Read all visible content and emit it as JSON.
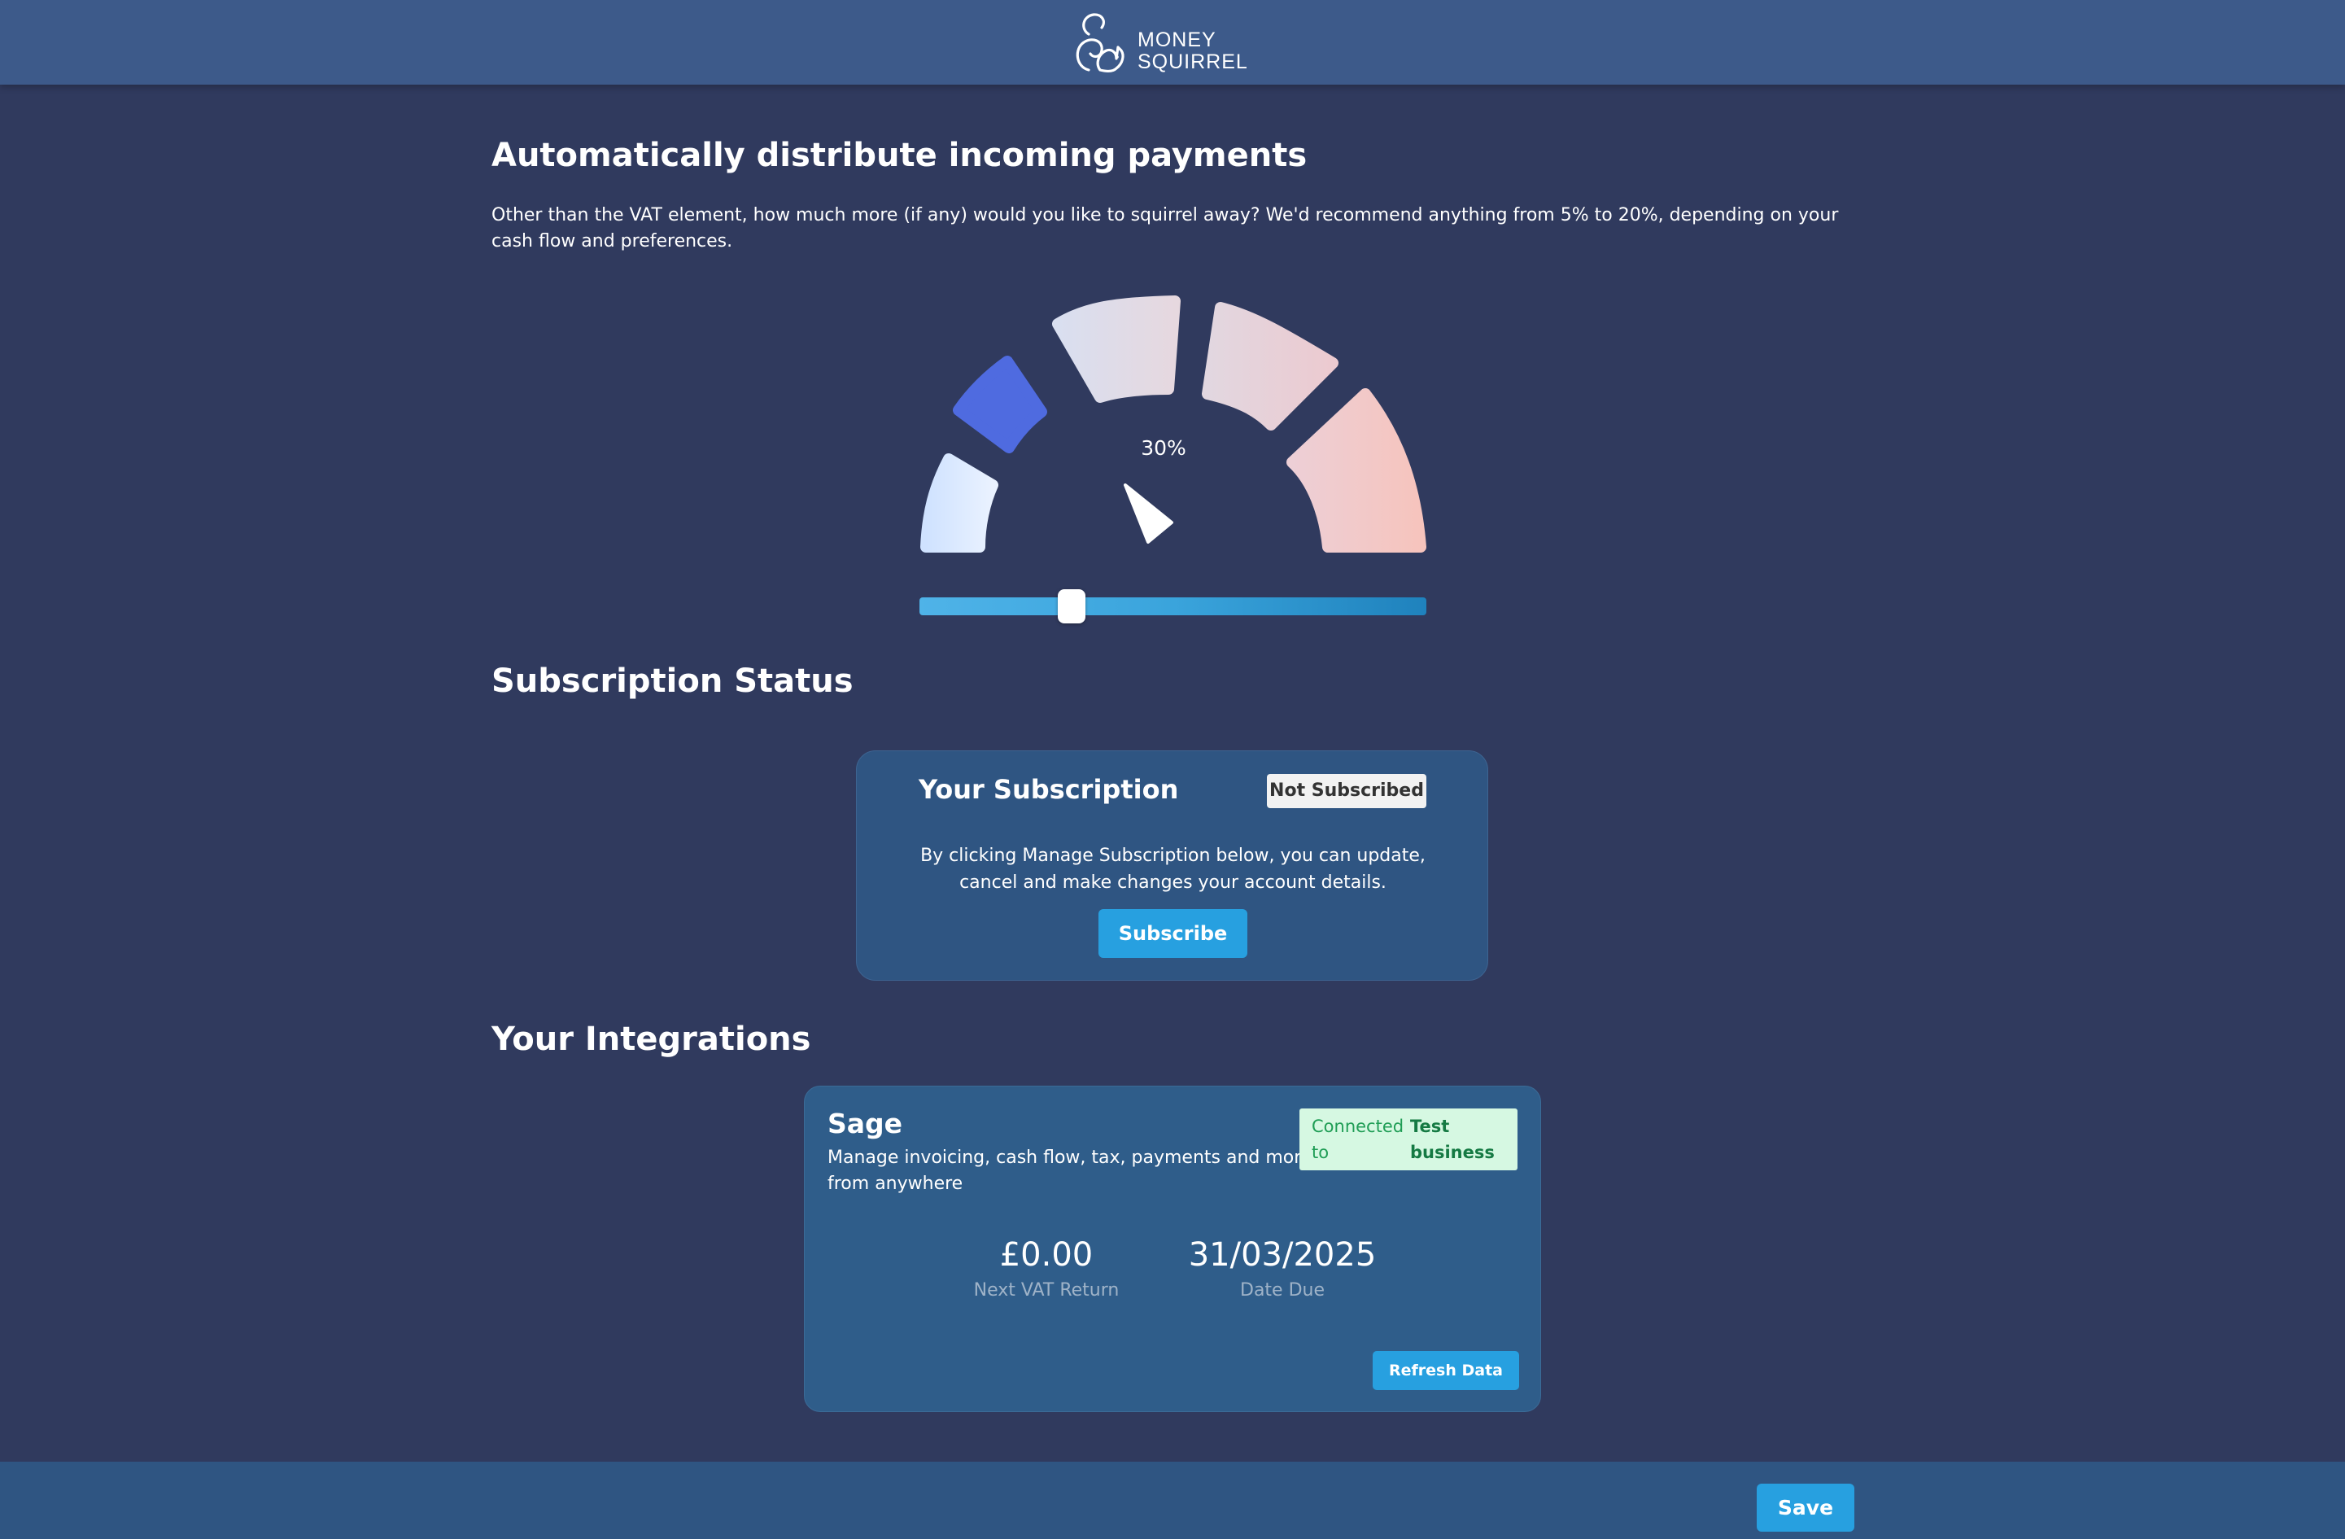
{
  "header": {
    "logo_line1": "MONEY",
    "logo_line2": "SQUIRREL",
    "icon": "squirrel-icon"
  },
  "distribute": {
    "title": "Automatically distribute incoming payments",
    "description": "Other than the VAT element, how much more (if any) would you like to squirrel away? We'd recommend anything from 5% to 20%, depending on your cash flow and preferences.",
    "gauge_value_label": "30%",
    "slider_value_percent": 30,
    "gauge_segments_active_index": 1,
    "gauge_colors": [
      "#dcebff",
      "#4f6be0",
      "#dedbe8",
      "#e8cfd6",
      "#f5c6c2"
    ]
  },
  "subscription": {
    "section_title": "Subscription Status",
    "card_title": "Your Subscription",
    "status_badge": "Not Subscribed",
    "description": "By clicking Manage Subscription below, you can update, cancel and make changes your account details.",
    "subscribe_label": "Subscribe"
  },
  "integrations": {
    "section_title": "Your Integrations",
    "items": [
      {
        "name": "Sage",
        "description": "Manage invoicing, cash flow, tax, payments and more from anywhere",
        "connected_label": "Connected to",
        "connected_value": "Test business",
        "next_vat_value": "£0.00",
        "next_vat_label": "Next VAT Return",
        "date_due_value": "31/03/2025",
        "date_due_label": "Date Due",
        "refresh_label": "Refresh Data"
      }
    ]
  },
  "footer": {
    "save_label": "Save"
  },
  "colors": {
    "background": "#303a5e",
    "topbar": "#3d5a8a",
    "card": "#2f5582",
    "accent": "#27a0e0",
    "connected_bg": "#d6f8e2",
    "connected_text": "#1f9d55"
  }
}
